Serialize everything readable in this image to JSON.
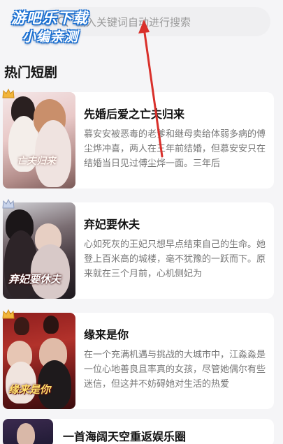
{
  "search": {
    "placeholder": "输入关键词自动进行搜索",
    "placeholder_visible_prefix": "输",
    "placeholder_visible": "入关键词自动进行搜索"
  },
  "watermark": {
    "line1": "游吧乐下载",
    "line2": "小编亲测"
  },
  "section": {
    "title": "热门短剧"
  },
  "dramas": [
    {
      "title": "先婚后爱之亡夫归来",
      "description": "慕安安被恶毒的老爹和继母卖给体弱多病的傅尘烨冲喜，两人在三年前结婚，但慕安安只在结婚当日见过傅尘烨一面。三年后",
      "poster_text": "亡夫归来",
      "badge_color": "#f2b53a"
    },
    {
      "title": "弃妃要休夫",
      "description": "心如死灰的王妃只想早点结束自己的生命。她登上百米高的城楼，毫不犹豫的一跃而下。原来就在三个月前，心机侧妃为",
      "poster_text": "弃妃要休夫",
      "badge_color": "#aab8d6"
    },
    {
      "title": "缘来是你",
      "description": "在一个充满机遇与挑战的大城市中，江淼淼是一位心地善良且率真的女孩，尽管她偶尔有些迷信，但这并不妨碍她对生活的热爱",
      "poster_text": "缘来是你",
      "badge_color": "#f2b53a"
    },
    {
      "title": "一首海阔天空重返娱乐圈",
      "description": "",
      "poster_text": "",
      "badge_color": ""
    }
  ],
  "colors": {
    "background": "#f5f5f7",
    "card": "#ffffff",
    "arrow": "#d9302b",
    "watermark_outline": "#1a6fd1"
  }
}
